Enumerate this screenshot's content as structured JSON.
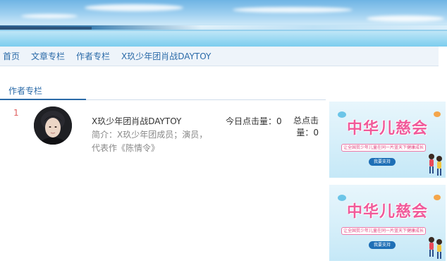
{
  "nav": {
    "items": [
      "首页",
      "文章专栏",
      "作者专栏",
      "X玖少年团肖战DAYTOY"
    ]
  },
  "section": {
    "title": "作者专栏"
  },
  "authors": [
    {
      "rank": "1",
      "name": "X玖少年团肖战DAYTOY",
      "desc": "简介：X玖少年团成员；演员，代表作《陈情令》",
      "today_clicks": "今日点击量：0",
      "total_clicks": "总点击量：0"
    }
  ],
  "ads": [
    {
      "title": "中华儿慈会",
      "slogan": "让全国贫少年儿童在同一片蓝天下健康成长",
      "button": "我要支持"
    },
    {
      "title": "中华儿慈会",
      "slogan": "让全国贫少年儿童在同一片蓝天下健康成长",
      "button": "我要支持"
    }
  ],
  "colors": {
    "nav_link": "#2a6aa8",
    "rank": "#e06060",
    "ad_title": "#f05a9a",
    "ad_button": "#1e6fb6"
  },
  "icons": {
    "avatar": "author-avatar-photo"
  }
}
